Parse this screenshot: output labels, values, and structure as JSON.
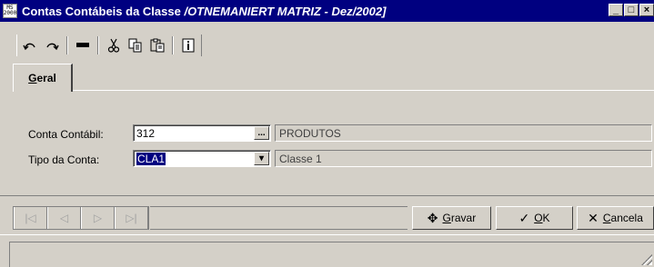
{
  "window": {
    "app_icon_top": "MS",
    "app_icon_bottom": "2000",
    "title": "Contas Contábeis da Classe",
    "title_context": "/OTNEMANIERT MATRIZ - Dez/2002]",
    "controls": {
      "minimize": "_",
      "restore": "□",
      "close": "×"
    }
  },
  "toolbar": {
    "icons": [
      "undo-icon",
      "redo-icon",
      "delete-icon",
      "cut-icon",
      "copy-icon",
      "paste-icon",
      "info-icon"
    ]
  },
  "tabs": [
    {
      "label_underlined": "G",
      "label_rest": "eral"
    }
  ],
  "form": {
    "conta_label": "Conta Contábil:",
    "conta_value": "312",
    "conta_lookup": "...",
    "conta_description": "PRODUTOS",
    "tipo_label": "Tipo da Conta:",
    "tipo_value": "CLA1",
    "tipo_dropdown": "▾",
    "tipo_description": "Classe 1"
  },
  "navigator": {
    "first": "|◁",
    "prior": "◁",
    "next": "▷",
    "last": "▷|"
  },
  "actions": {
    "gravar": {
      "icon": "✥",
      "underlined": "G",
      "rest": "ravar"
    },
    "ok": {
      "icon": "✓",
      "underlined": "O",
      "rest": "K"
    },
    "cancela": {
      "icon": "✕",
      "underlined": "C",
      "rest": "ancela"
    }
  }
}
